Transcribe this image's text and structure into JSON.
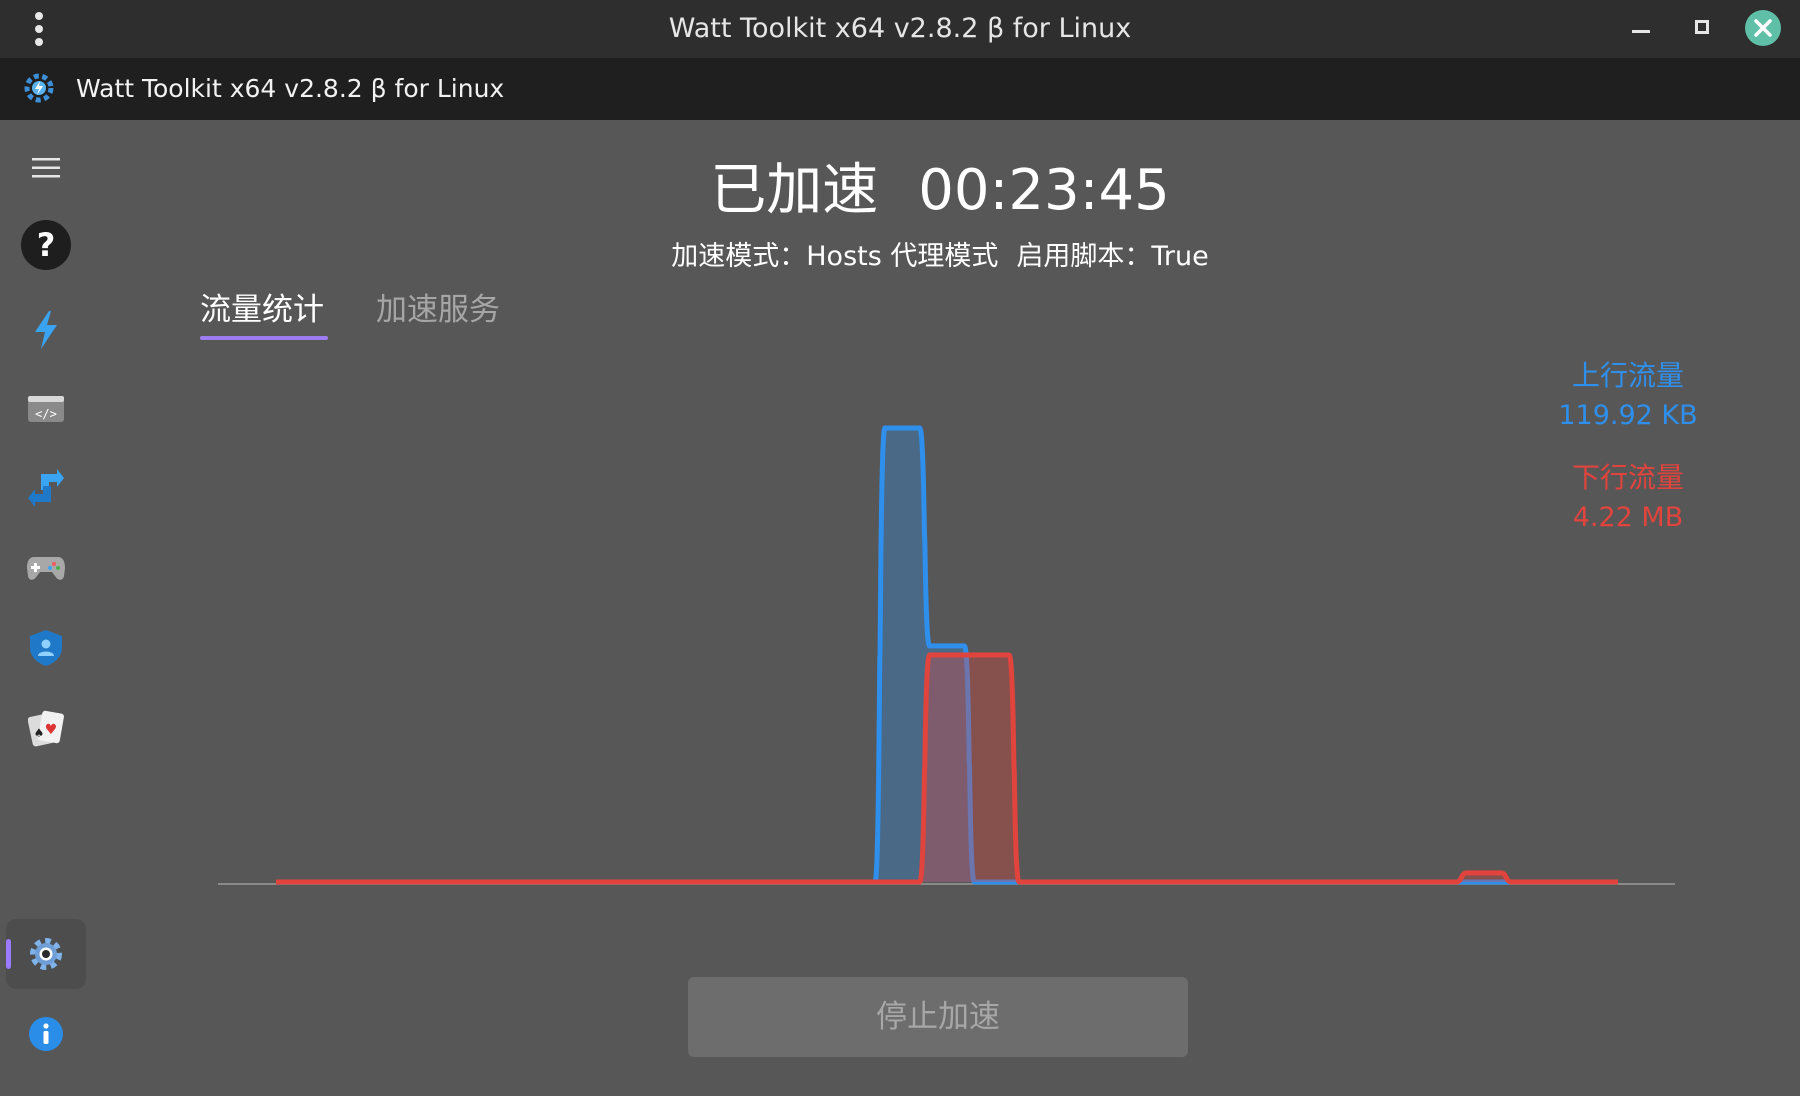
{
  "window": {
    "title": "Watt Toolkit x64 v2.8.2 β for Linux"
  },
  "app": {
    "title": "Watt Toolkit x64 v2.8.2 β for Linux"
  },
  "sidebar": {
    "items": [
      {
        "icon": "hamburger-menu-icon"
      },
      {
        "icon": "help-icon"
      },
      {
        "icon": "lightning-icon"
      },
      {
        "icon": "script-icon"
      },
      {
        "icon": "transfer-arrows-icon"
      },
      {
        "icon": "gamepad-icon"
      },
      {
        "icon": "shield-user-icon"
      },
      {
        "icon": "cards-icon"
      },
      {
        "icon": "gear-icon",
        "active": true
      },
      {
        "icon": "info-icon"
      }
    ]
  },
  "main": {
    "status_label": "已加速",
    "elapsed": "00:23:45",
    "mode_label": "加速模式：",
    "mode_value": "Hosts 代理模式",
    "script_label": "启用脚本：",
    "script_value": "True",
    "tabs": [
      {
        "label": "流量统计",
        "active": true
      },
      {
        "label": "加速服务",
        "active": false
      }
    ],
    "stop_button": "停止加速"
  },
  "colors": {
    "upload": "#2e8fec",
    "download": "#e0443d",
    "accent": "#9d7cf2",
    "background": "#575757"
  },
  "chart_data": {
    "type": "area",
    "series": [
      {
        "name": "上行流量",
        "total": "119.92 KB",
        "values": [
          0,
          0,
          0,
          0,
          0,
          0,
          0,
          0,
          0,
          0,
          0,
          0,
          0,
          0,
          1,
          0.52,
          0,
          0,
          0,
          0,
          0,
          0,
          0,
          0,
          0,
          0,
          0,
          0,
          0,
          0,
          0
        ]
      },
      {
        "name": "下行流量",
        "total": "4.22 MB",
        "values": [
          0,
          0,
          0,
          0,
          0,
          0,
          0,
          0,
          0,
          0,
          0,
          0,
          0,
          0,
          0,
          0.5,
          0.5,
          0,
          0,
          0,
          0,
          0,
          0,
          0,
          0,
          0,
          0,
          0.02,
          0,
          0,
          0
        ]
      }
    ]
  }
}
